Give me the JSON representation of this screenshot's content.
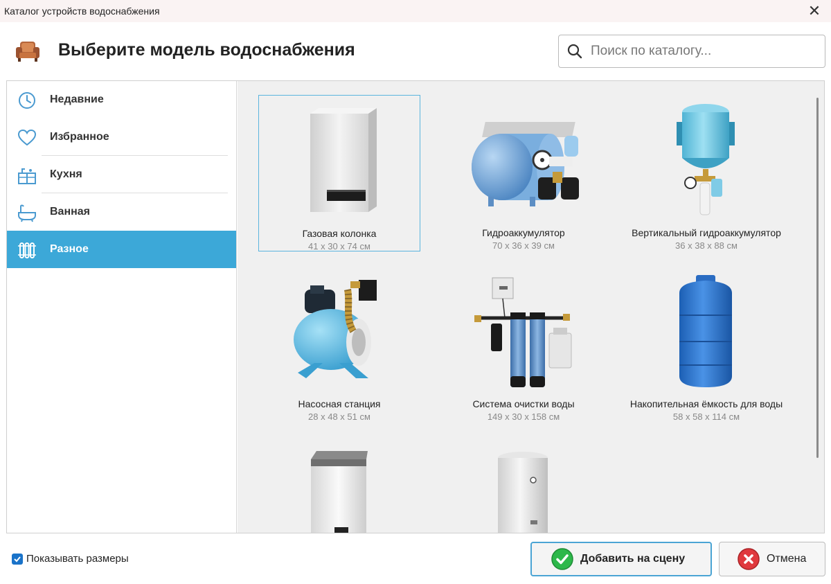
{
  "window": {
    "title": "Каталог устройств водоснабжения"
  },
  "header": {
    "heading": "Выберите модель водоснабжения",
    "search_placeholder": "Поиск по каталогу..."
  },
  "sidebar": {
    "items": [
      {
        "label": "Недавние",
        "icon": "clock-icon"
      },
      {
        "label": "Избранное",
        "icon": "heart-icon"
      },
      {
        "label": "Кухня",
        "icon": "kitchen-icon"
      },
      {
        "label": "Ванная",
        "icon": "bathtub-icon"
      },
      {
        "label": "Разное",
        "icon": "radiator-icon",
        "active": true
      }
    ]
  },
  "catalog": {
    "items": [
      {
        "name": "Газовая колонка",
        "dims": "41 x 30 x 74 см",
        "selected": true
      },
      {
        "name": "Гидроаккумулятор",
        "dims": "70 x 36 x 39 см"
      },
      {
        "name": "Вертикальный гидроаккумулятор",
        "dims": "36 x 38 x 88 см"
      },
      {
        "name": "Насосная станция",
        "dims": "28 x 48 x 51 см"
      },
      {
        "name": "Система очистки воды",
        "dims": "149 x 30 x 158 см"
      },
      {
        "name": "Накопительная ёмкость для воды",
        "dims": "58 x 58 x 114 см"
      },
      {
        "name": "",
        "dims": ""
      },
      {
        "name": "",
        "dims": ""
      }
    ]
  },
  "footer": {
    "show_sizes_label": "Показывать размеры",
    "show_sizes_checked": true,
    "add_button": "Добавить на сцену",
    "cancel_button": "Отмена"
  },
  "colors": {
    "accent": "#3ca8d8",
    "checkbox": "#1a73c9",
    "ok_green": "#2db84a",
    "cancel_red": "#e0393e"
  }
}
